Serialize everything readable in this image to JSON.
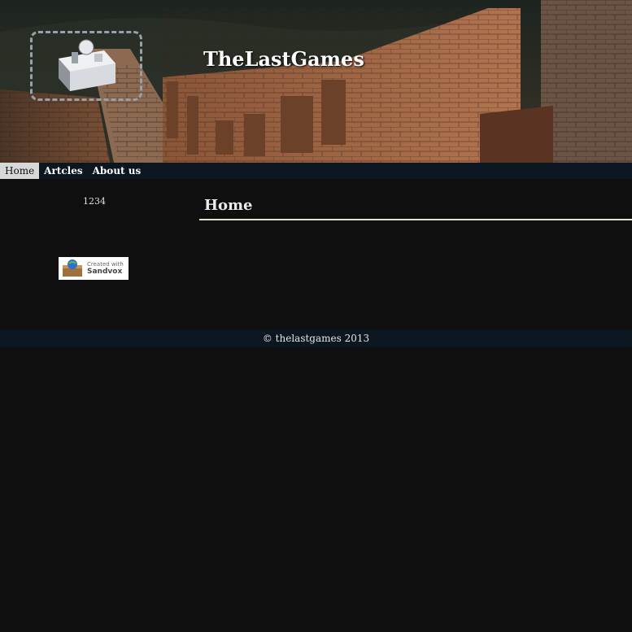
{
  "header": {
    "site_title": "TheLastGames"
  },
  "nav": {
    "items": [
      {
        "label": "Home",
        "active": true
      },
      {
        "label": "Artcles",
        "active": false
      },
      {
        "label": "About us",
        "active": false
      }
    ]
  },
  "sidebar": {
    "text": "1234",
    "badge": {
      "line1": "Created with",
      "line2": "Sandvox"
    }
  },
  "main": {
    "heading": "Home"
  },
  "footer": {
    "copyright": "© thelastgames 2013"
  },
  "colors": {
    "background": "#0f0f0f",
    "nav_bar": "#0c1620",
    "active_tab": "#d8d8d8"
  }
}
